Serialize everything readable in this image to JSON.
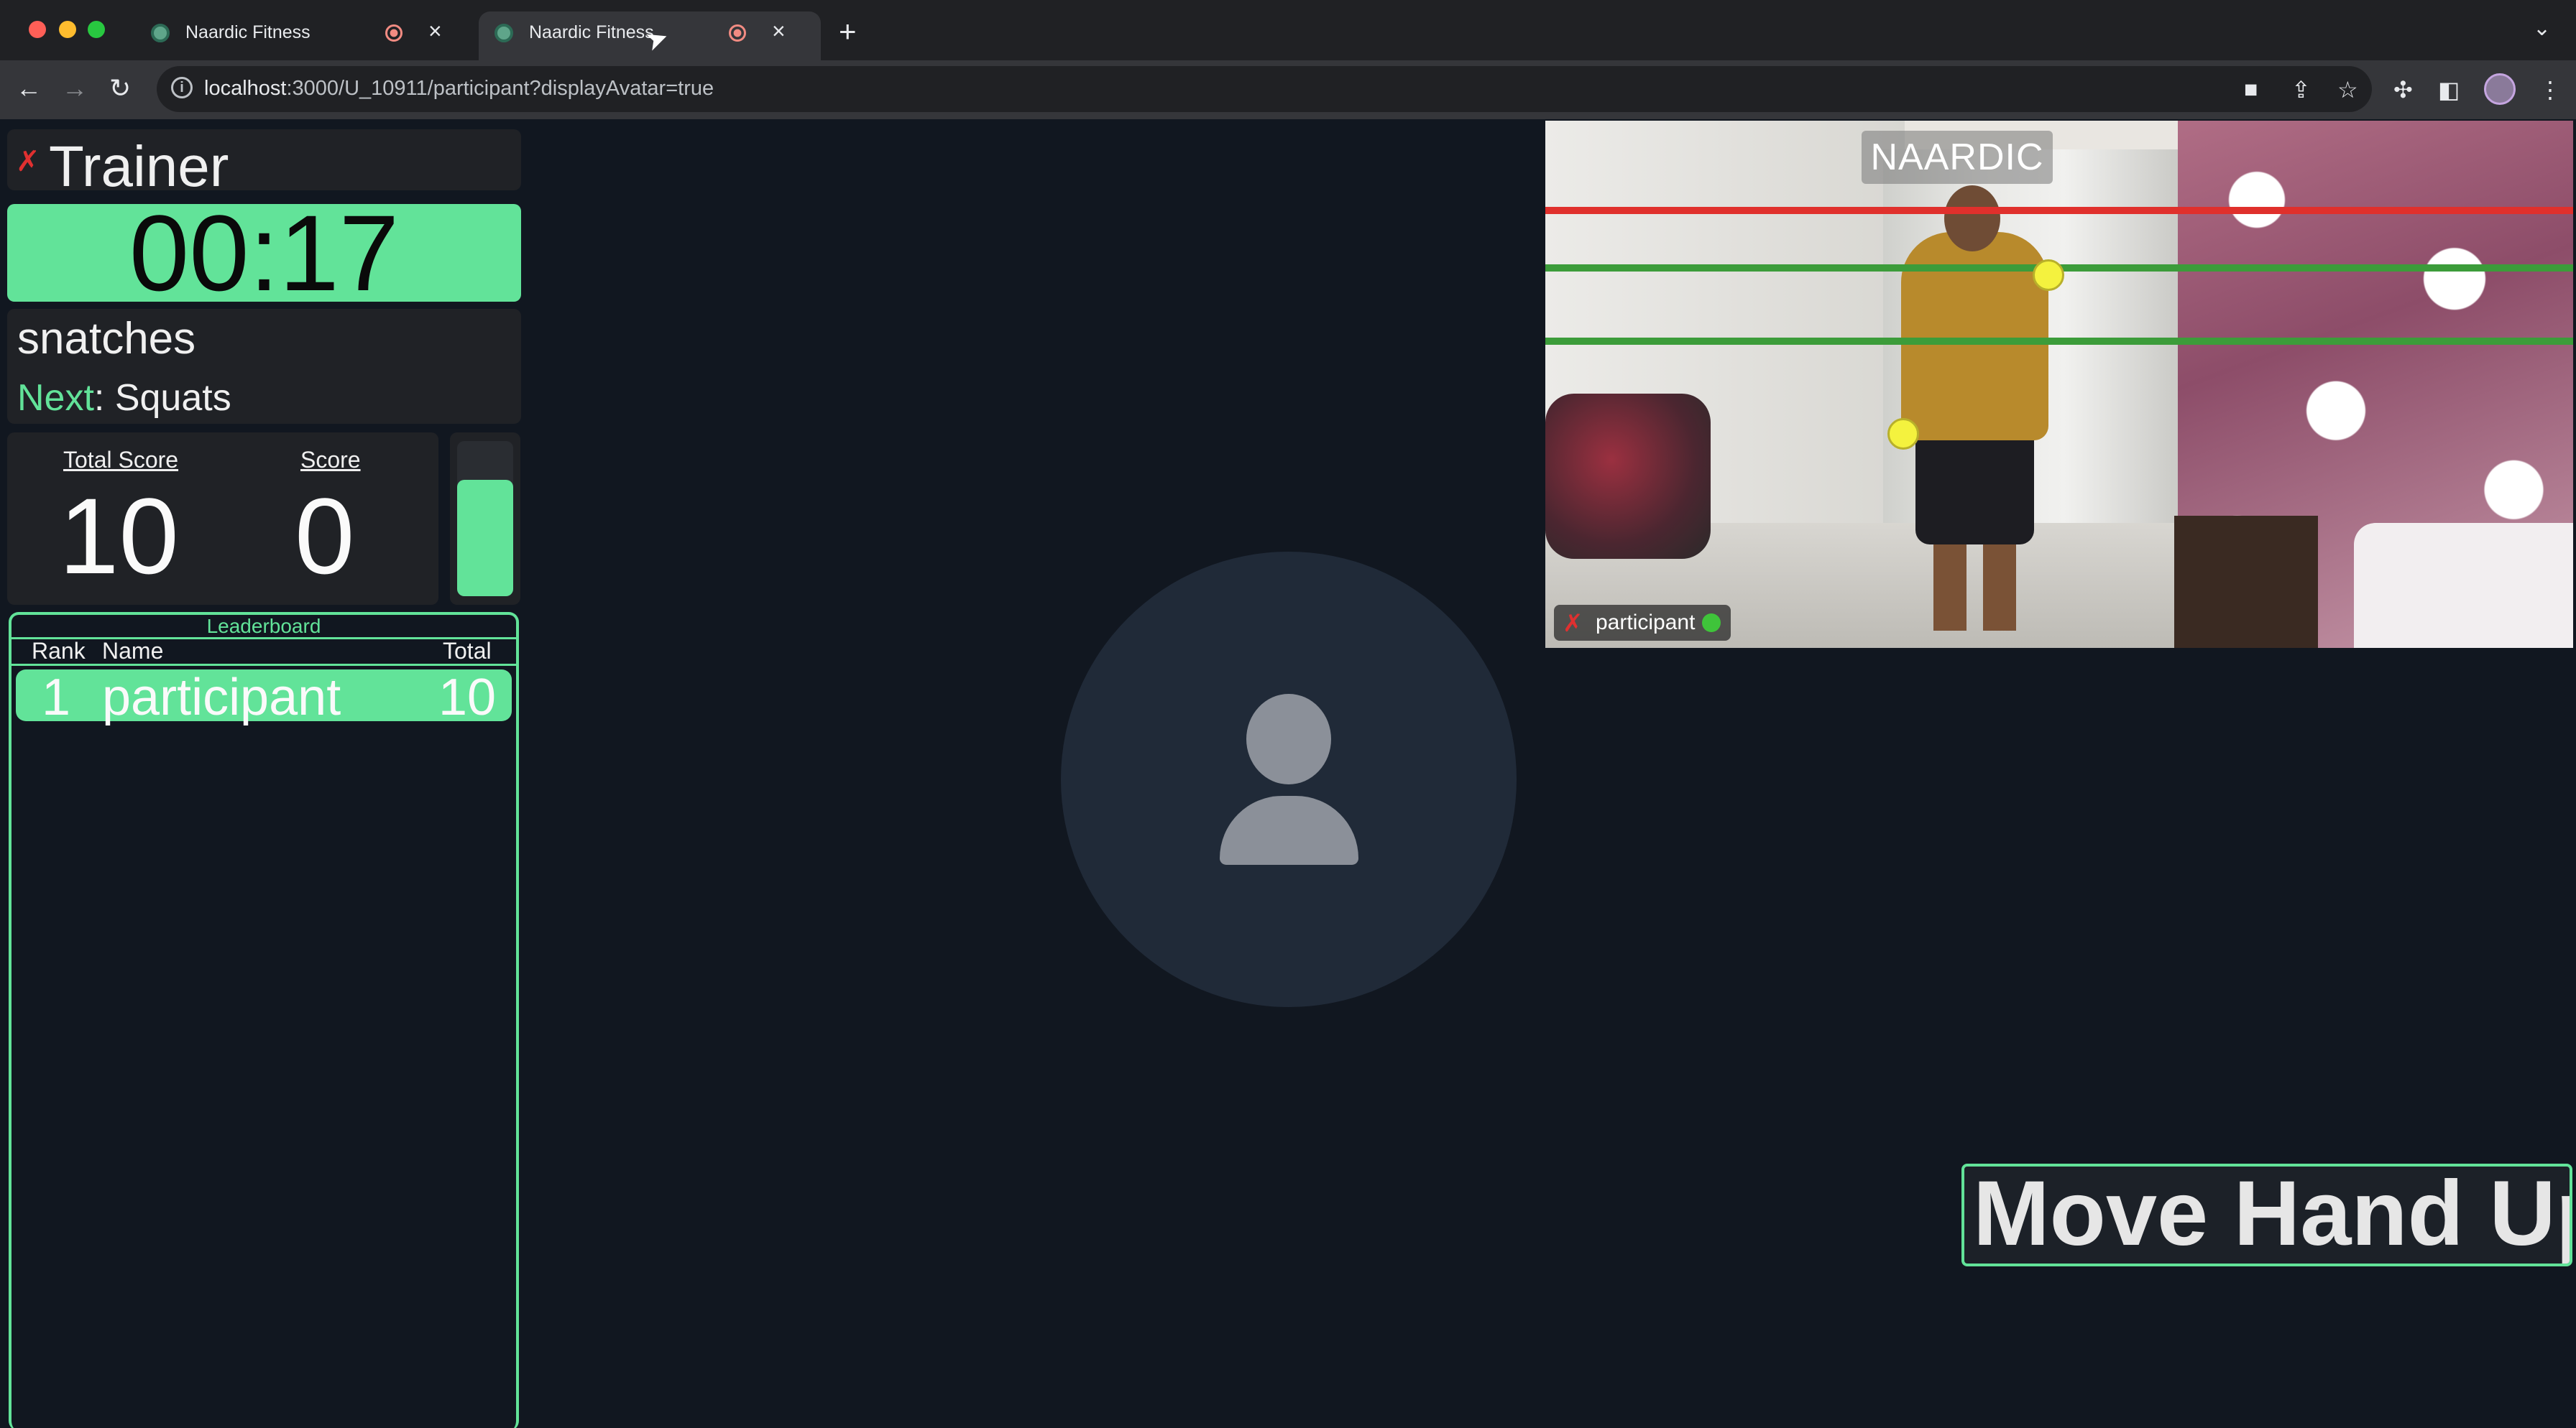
{
  "browser": {
    "tabs": [
      {
        "title": "Naardic Fitness",
        "active": false
      },
      {
        "title": "Naardic Fitness",
        "active": true
      }
    ],
    "url_host": "localhost",
    "url_rest": ":3000/U_10911/participant?displayAvatar=true",
    "colors": {
      "tabbar": "#202124",
      "toolbar": "#35363a",
      "close": "#ff5f57",
      "minimize": "#febc2e",
      "zoom": "#28c840"
    }
  },
  "trainer": {
    "name": "Trainer",
    "mic_muted": true
  },
  "timer": {
    "value": "00:17"
  },
  "exercise": {
    "current": "snatches",
    "next_label": "Next",
    "next_sep": ":",
    "next_value": "Squats"
  },
  "scores": {
    "total_label": "Total Score",
    "total_value": "10",
    "score_label": "Score",
    "score_value": "0",
    "meter_fill": 0.75
  },
  "leaderboard": {
    "title": "Leaderboard",
    "columns": [
      "Rank",
      "Name",
      "Total"
    ],
    "rows": [
      {
        "rank": "1",
        "name": "participant",
        "total": "10"
      }
    ]
  },
  "video": {
    "logo": "NAARDIC",
    "participant_label": "participant",
    "status": "online",
    "line_colors": {
      "limit": "#e0302c",
      "target": "#3c9c3a"
    }
  },
  "instruction": "Move Hand Up",
  "accent": "#62e399",
  "background": "#111720"
}
